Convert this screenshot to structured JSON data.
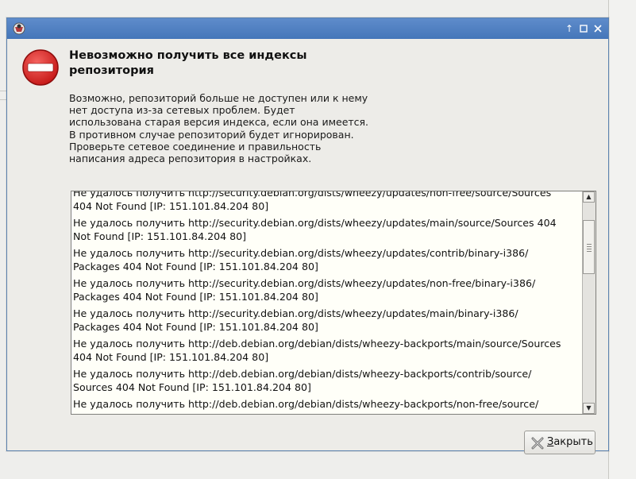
{
  "dialog": {
    "heading_lines": [
      "Невозможно получить все индексы",
      "репозитория"
    ],
    "message_lines": [
      "Возможно, репозиторий больше не доступен или к нему",
      "нет доступа из-за сетевых проблем. Будет",
      "использована старая версия индекса, если она имеется.",
      "В противном случае репозиторий будет игнорирован.",
      "Проверьте сетевое соединение и правильность",
      "написания адреса репозитория в настройках."
    ],
    "log_entries": [
      [
        "Не удалось получить http://security.debian.org/dists/wheezy/updates/non-free/source/Sources",
        "404  Not Found [IP: 151.101.84.204 80]"
      ],
      [
        "Не удалось получить http://security.debian.org/dists/wheezy/updates/main/source/Sources  404",
        "Not Found [IP: 151.101.84.204 80]"
      ],
      [
        "Не удалось получить http://security.debian.org/dists/wheezy/updates/contrib/binary-i386/",
        "Packages  404  Not Found [IP: 151.101.84.204 80]"
      ],
      [
        "Не удалось получить http://security.debian.org/dists/wheezy/updates/non-free/binary-i386/",
        "Packages  404  Not Found [IP: 151.101.84.204 80]"
      ],
      [
        "Не удалось получить http://security.debian.org/dists/wheezy/updates/main/binary-i386/",
        "Packages  404  Not Found [IP: 151.101.84.204 80]"
      ],
      [
        "Не удалось получить http://deb.debian.org/debian/dists/wheezy-backports/main/source/Sources",
        "404  Not Found [IP: 151.101.84.204 80]"
      ],
      [
        "Не удалось получить http://deb.debian.org/debian/dists/wheezy-backports/contrib/source/",
        "Sources  404  Not Found [IP: 151.101.84.204 80]"
      ],
      [
        "Не удалось получить http://deb.debian.org/debian/dists/wheezy-backports/non-free/source/",
        ""
      ]
    ],
    "close_button": {
      "mnemonic": "З",
      "rest": "акрыть"
    }
  },
  "icons": {
    "app": "synaptic-icon",
    "error": "error-stop-icon",
    "close_button": "close-x-icon"
  },
  "colors": {
    "titlebar": "#4a7cbe",
    "error_red": "#d9201f"
  }
}
